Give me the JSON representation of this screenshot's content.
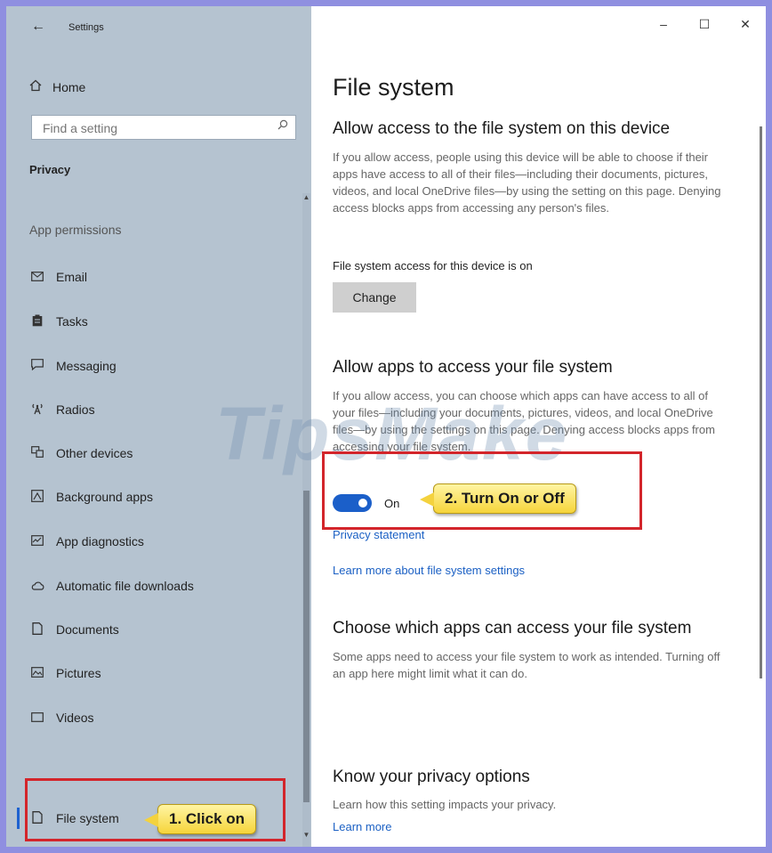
{
  "sidebar": {
    "back_glyph": "←",
    "app_title": "Settings",
    "home": {
      "icon": "home-icon",
      "label": "Home"
    },
    "search": {
      "placeholder": "Find a setting",
      "icon": "search-icon"
    },
    "section": "Privacy",
    "group": "App permissions",
    "items": [
      {
        "icon": "mail-icon",
        "label": "Email"
      },
      {
        "icon": "clipboard-icon",
        "label": "Tasks"
      },
      {
        "icon": "chat-icon",
        "label": "Messaging"
      },
      {
        "icon": "antenna-icon",
        "label": "Radios"
      },
      {
        "icon": "devices-icon",
        "label": "Other devices"
      },
      {
        "icon": "background-apps-icon",
        "label": "Background apps"
      },
      {
        "icon": "diagnostics-icon",
        "label": "App diagnostics"
      },
      {
        "icon": "cloud-icon",
        "label": "Automatic file downloads"
      },
      {
        "icon": "document-icon",
        "label": "Documents"
      },
      {
        "icon": "picture-icon",
        "label": "Pictures"
      },
      {
        "icon": "video-icon",
        "label": "Videos"
      },
      {
        "icon": "document-icon",
        "label": "File system",
        "selected": true
      }
    ]
  },
  "window_controls": {
    "minimize": "–",
    "maximize": "☐",
    "close": "✕"
  },
  "main": {
    "title": "File system",
    "section1": {
      "heading": "Allow access to the file system on this device",
      "body": "If you allow access, people using this device will be able to choose if their apps have access to all of their files—including their documents, pictures, videos, and local OneDrive files—by using the setting on this page. Denying access blocks apps from accessing any person's files.",
      "status": "File system access for this device is on",
      "button": "Change"
    },
    "section2": {
      "heading": "Allow apps to access your file system",
      "body": "If you allow access, you can choose which apps can have access to all of your files—including your documents, pictures, videos, and local OneDrive files—by using the settings on this page. Denying access blocks apps from accessing your file system.",
      "toggle_state": "On",
      "privacy_link": "Privacy statement",
      "learn_link": "Learn more about file system settings"
    },
    "section3": {
      "heading": "Choose which apps can access your file system",
      "body": "Some apps need to access your file system to work as intended. Turning off an app here might limit what it can do."
    },
    "section4": {
      "heading": "Know your privacy options",
      "body": "Learn how this setting impacts your privacy.",
      "link": "Learn more"
    }
  },
  "annotations": {
    "callout1": "1. Click on",
    "callout2": "2. Turn On or Off",
    "accent_color": "#d3252b",
    "callout_color": "#f6d43a"
  },
  "watermark": "TipsMake"
}
